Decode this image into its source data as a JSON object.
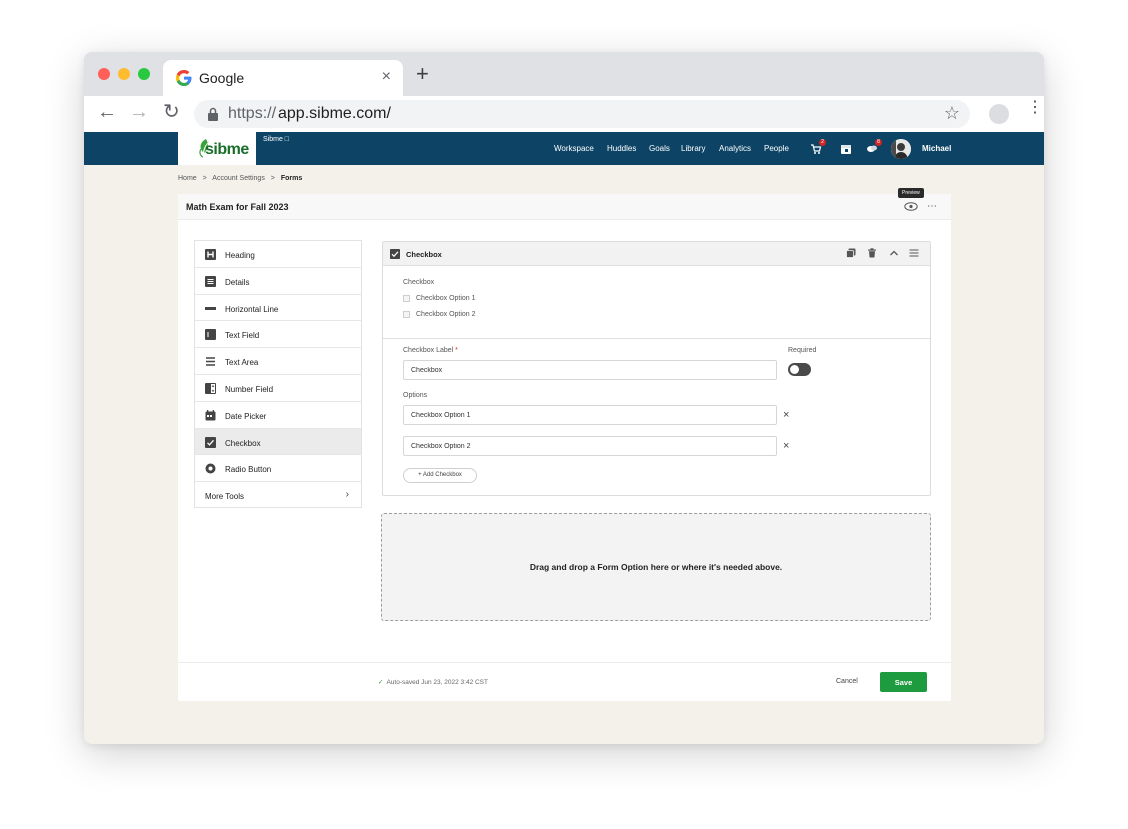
{
  "browser": {
    "tab_title": "Google",
    "tab_close": "×",
    "new_tab": "+",
    "url_protocol": "https://",
    "url_host": "app.sibme.com/"
  },
  "header": {
    "logo_text": "sibme",
    "brand_small": "Sibme",
    "nav": [
      "Workspace",
      "Huddles",
      "Goals",
      "Library",
      "Analytics",
      "People"
    ],
    "badges": [
      "2",
      "8"
    ],
    "user_name": "Michael"
  },
  "breadcrumb": {
    "items": [
      "Home",
      "Account Settings",
      "Forms"
    ],
    "separator": ">"
  },
  "form": {
    "title": "Math Exam for Fall 2023",
    "preview_tooltip": "Preview"
  },
  "tools": [
    {
      "label": "Heading",
      "icon": "heading-icon"
    },
    {
      "label": "Details",
      "icon": "details-icon"
    },
    {
      "label": "Horizontal Line",
      "icon": "horizontal-line-icon"
    },
    {
      "label": "Text Field",
      "icon": "text-field-icon"
    },
    {
      "label": "Text Area",
      "icon": "text-area-icon"
    },
    {
      "label": "Number Field",
      "icon": "number-field-icon"
    },
    {
      "label": "Date Picker",
      "icon": "calendar-icon"
    },
    {
      "label": "Checkbox",
      "icon": "checkbox-icon",
      "active": true
    },
    {
      "label": "Radio Button",
      "icon": "radio-icon"
    },
    {
      "label": "More Tools",
      "icon": "chevron-right-icon"
    }
  ],
  "editor": {
    "title": "Checkbox",
    "preview_label": "Checkbox",
    "preview_options": [
      "Checkbox Option 1",
      "Checkbox Option 2"
    ],
    "label_field_label": "Checkbox Label",
    "required_star": "*",
    "label_value": "Checkbox",
    "required_label": "Required",
    "required_on": false,
    "options_label": "Options",
    "option_values": [
      "Checkbox Option 1",
      "Checkbox Option 2"
    ],
    "remove_glyph": "×",
    "add_button": "+ Add Checkbox"
  },
  "dropzone": {
    "text": "Drag and drop a Form Option here or where it's needed above."
  },
  "footer": {
    "saved_check": "✓",
    "saved_text": "Auto-saved Jun 23, 2022 3:42 CST",
    "cancel": "Cancel",
    "save": "Save"
  },
  "colors": {
    "header_bg": "#0d4466",
    "accent_green": "#1e9a3f",
    "badge_red": "#d02626"
  }
}
